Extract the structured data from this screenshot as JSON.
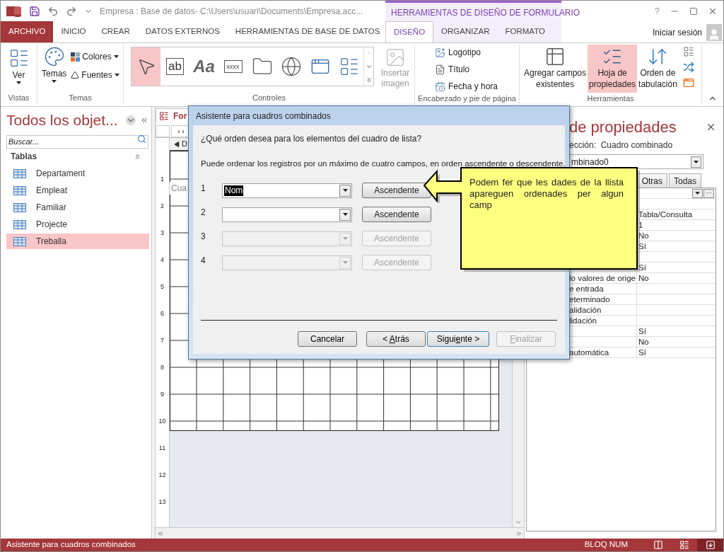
{
  "title_bar": {
    "title": "Empresa : Base de datos- C:\\Users\\usuari\\Documents\\Empresa.acc...",
    "context_title": "HERRAMIENTAS DE DISEÑO DE FORMULARIO",
    "help": "?"
  },
  "ribbon_tabs": [
    {
      "label": "ARCHIVO",
      "kind": "file",
      "selected": false
    },
    {
      "label": "INICIO",
      "kind": "tab",
      "selected": false
    },
    {
      "label": "CREAR",
      "kind": "tab",
      "selected": false
    },
    {
      "label": "DATOS EXTERNOS",
      "kind": "tab",
      "selected": false
    },
    {
      "label": "HERRAMIENTAS DE BASE DE DATOS",
      "kind": "tab",
      "selected": false
    },
    {
      "label": "DISEÑO",
      "kind": "context",
      "selected": true
    },
    {
      "label": "ORGANIZAR",
      "kind": "context",
      "selected": false
    },
    {
      "label": "FORMATO",
      "kind": "context",
      "selected": false
    }
  ],
  "account": {
    "label": "Iniciar sesión"
  },
  "ribbon": {
    "views": {
      "name": "Vistas",
      "button": "Ver"
    },
    "themes": {
      "name": "Temas",
      "button": "Temas",
      "colors": "Colores",
      "fonts": "Fuentes"
    },
    "controls": {
      "name": "Controles",
      "tools": [
        {
          "kind": "pointer",
          "selected": true
        },
        {
          "kind": "textbox",
          "label": "ab",
          "selected": false
        },
        {
          "kind": "label",
          "label": "Aa",
          "selected": false
        },
        {
          "kind": "button",
          "label": "xxxx",
          "selected": false
        },
        {
          "kind": "tab",
          "selected": false
        },
        {
          "kind": "hyperlink",
          "selected": false
        },
        {
          "kind": "browser",
          "selected": false
        },
        {
          "kind": "navigation",
          "selected": false
        }
      ]
    },
    "image": {
      "lines": [
        "Insertar",
        "imagen"
      ],
      "disabled": true
    },
    "header_footer": {
      "name": "Encabezado y pie de página",
      "items": [
        {
          "kind": "logo",
          "label": "Logotipo"
        },
        {
          "kind": "title",
          "label": "Título"
        },
        {
          "kind": "datetime",
          "label": "Fecha y hora"
        }
      ]
    },
    "tools": {
      "name": "Herramientas",
      "items": [
        {
          "kind": "fields",
          "lines": [
            "Agregar campos",
            "existentes"
          ],
          "selected": false
        },
        {
          "kind": "sheet",
          "lines": [
            "Hoja de",
            "propiedades"
          ],
          "selected": true
        },
        {
          "kind": "taborder",
          "lines": [
            "Orden de",
            "tabulación"
          ],
          "selected": false
        }
      ]
    }
  },
  "nav": {
    "title": "Todos los objet...",
    "search": {
      "placeholder": "Buscar..."
    },
    "section": "Tablas",
    "items": [
      {
        "label": "Departament",
        "selected": false
      },
      {
        "label": "Empleat",
        "selected": false
      },
      {
        "label": "Familiar",
        "selected": false
      },
      {
        "label": "Projecte",
        "selected": false
      },
      {
        "label": "Treballa",
        "selected": true
      }
    ]
  },
  "designer": {
    "tab": "For",
    "section": "D",
    "label_control": "Cua",
    "ruler": [
      "1",
      "2",
      "3",
      "4",
      "5",
      "6",
      "7",
      "8",
      "9",
      "10",
      "11",
      "12",
      "13"
    ]
  },
  "dialog": {
    "title": "Asistente para cuadros combinados",
    "question": "¿Qué orden desea para los elementos del cuadro de lista?",
    "description": "Puede ordenar los registros por un máximo de cuatro campos, en orden ascendente o descendente.",
    "rows": [
      {
        "number": "1",
        "value": "Nom",
        "order": "Ascendente",
        "disabled": false
      },
      {
        "number": "2",
        "order": "Ascendente",
        "disabled": false
      },
      {
        "number": "3",
        "order": "Ascendente",
        "disabled": true
      },
      {
        "number": "4",
        "order": "Ascendente",
        "disabled": true
      }
    ],
    "buttons": [
      {
        "before": "Cancelar",
        "disabled": false,
        "default": false
      },
      {
        "before": "< ",
        "key": "A",
        "after": "trás",
        "disabled": false,
        "default": false
      },
      {
        "before": "Sigui",
        "key": "e",
        "after": "nte >",
        "disabled": false,
        "default": true
      },
      {
        "key": "F",
        "after": "inalizar",
        "disabled": true,
        "default": false
      }
    ]
  },
  "callout": {
    "text": "Podem fer que les dades de la llista apareguen ordenades per algun camp"
  },
  "property_sheet": {
    "title": "de propiedades",
    "selection": "ección:  Cuadro combinado",
    "object": "mbinado0",
    "tabs": [
      {
        "label": "Otras",
        "selected": false
      },
      {
        "label": "Todas",
        "selected": false
      }
    ],
    "rows": [
      {
        "kind": "builder",
        "label": "···"
      },
      {
        "kind": "row"
      },
      {
        "kind": "row",
        "value": "Tabla/Consulta"
      },
      {
        "kind": "row",
        "value": "1"
      },
      {
        "kind": "row",
        "value": "No"
      },
      {
        "kind": "row",
        "value": "Sí"
      },
      {
        "kind": "row"
      },
      {
        "kind": "row",
        "value": "Sí"
      },
      {
        "kind": "row",
        "name": "lo valores de orige",
        "value": "No"
      },
      {
        "kind": "row",
        "name": "e entrada"
      },
      {
        "kind": "row",
        "name": "eterminado"
      },
      {
        "kind": "row",
        "name": "alidación"
      },
      {
        "kind": "row",
        "name": "lidación"
      },
      {
        "kind": "row",
        "value": "Sí"
      },
      {
        "kind": "row",
        "value": "No"
      },
      {
        "kind": "row",
        "name": "automática",
        "value": "Sí"
      }
    ]
  },
  "status_bar": {
    "text": "Asistente para cuadros combinados",
    "indicator": "BLOQ NUM",
    "views": [
      {
        "kind": "form",
        "selected": false
      },
      {
        "kind": "layout",
        "selected": false
      },
      {
        "kind": "design",
        "selected": true
      }
    ]
  }
}
